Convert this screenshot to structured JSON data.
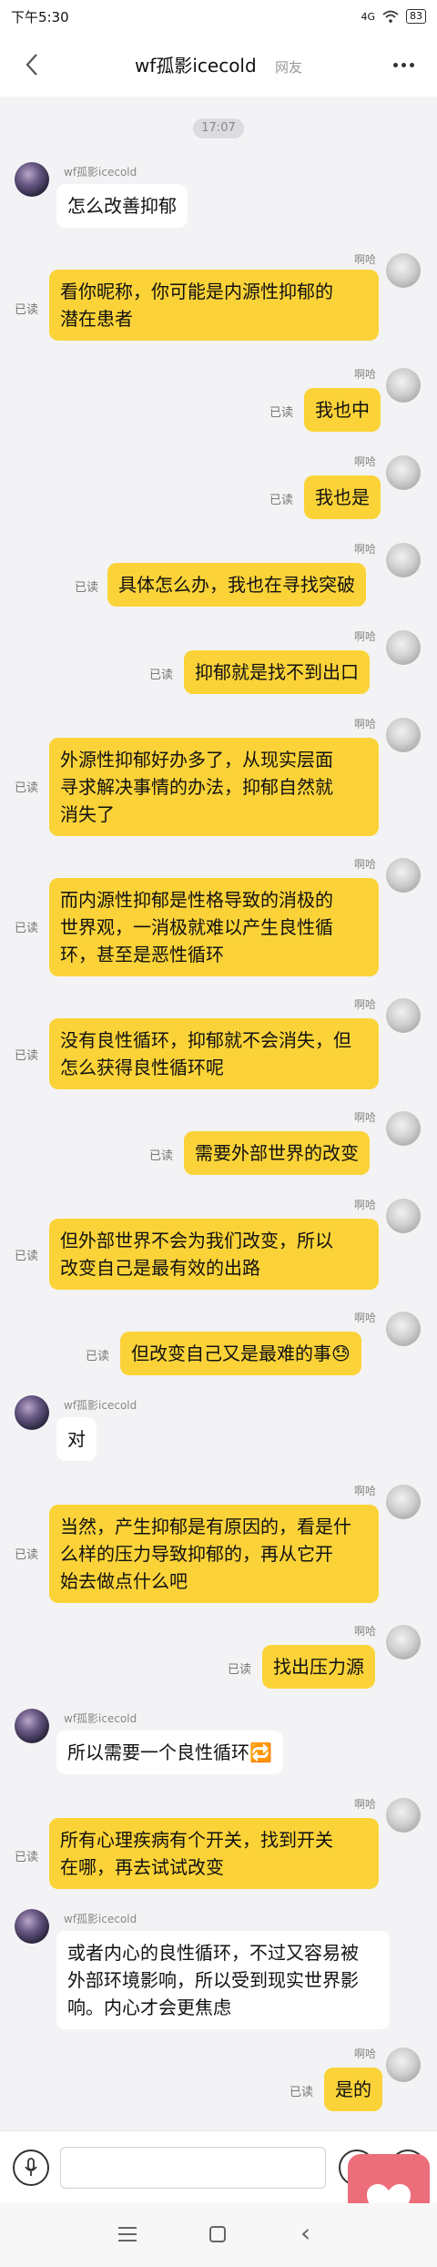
{
  "status": {
    "time": "下午5:30",
    "signal": "4G",
    "battery": "83"
  },
  "header": {
    "title": "wf孤影icecold",
    "tag": "网友"
  },
  "chat": {
    "timestamp": "17:07",
    "other_name": "wf孤影icecold",
    "my_name": "啊哈",
    "read_label": "已读",
    "messages": [
      {
        "side": "in",
        "text": "怎么改善抑郁"
      },
      {
        "side": "out",
        "text": "看你昵称，你可能是内源性抑郁的\n潜在患者"
      },
      {
        "side": "out",
        "text": "我也中"
      },
      {
        "side": "out",
        "text": "我也是"
      },
      {
        "side": "out",
        "text": "具体怎么办，我也在寻找突破"
      },
      {
        "side": "out",
        "text": "抑郁就是找不到出口"
      },
      {
        "side": "out",
        "text": "外源性抑郁好办多了，从现实层面\n寻求解决事情的办法，抑郁自然就\n消失了"
      },
      {
        "side": "out",
        "text": "而内源性抑郁是性格导致的消极的\n世界观，一消极就难以产生良性循\n环，甚至是恶性循环"
      },
      {
        "side": "out",
        "text": "没有良性循环，抑郁就不会消失，但\n怎么获得良性循环呢"
      },
      {
        "side": "out",
        "text": "需要外部世界的改变"
      },
      {
        "side": "out",
        "text": "但外部世界不会为我们改变，所以\n改变自己是最有效的出路"
      },
      {
        "side": "out",
        "text": "但改变自己又是最难的事😓"
      },
      {
        "side": "in",
        "text": "对"
      },
      {
        "side": "out",
        "text": "当然，产生抑郁是有原因的，看是什\n么样的压力导致抑郁的，再从它开\n始去做点什么吧"
      },
      {
        "side": "out",
        "text": "找出压力源"
      },
      {
        "side": "in",
        "text": "所以需要一个良性循环🔁"
      },
      {
        "side": "out",
        "text": "所有心理疾病有个开关，找到开关\n在哪，再去试试改变"
      },
      {
        "side": "in",
        "text": "或者内心的良性循环，不过又容易被\n外部环境影响，所以受到现实世界影\n响。内心才会更焦虑"
      },
      {
        "side": "out",
        "text": "是的"
      }
    ]
  },
  "input": {
    "placeholder": ""
  },
  "icons": {
    "back": "back-arrow-icon",
    "more": "more-dots-icon",
    "mic": "microphone-icon",
    "emoji": "emoji-icon",
    "plus": "plus-icon",
    "heart": "heart-icon"
  },
  "colors": {
    "out_bubble": "#fbd338",
    "in_bubble": "#ffffff",
    "background": "#f3f3f5",
    "heart_badge": "#ec6e7a"
  }
}
